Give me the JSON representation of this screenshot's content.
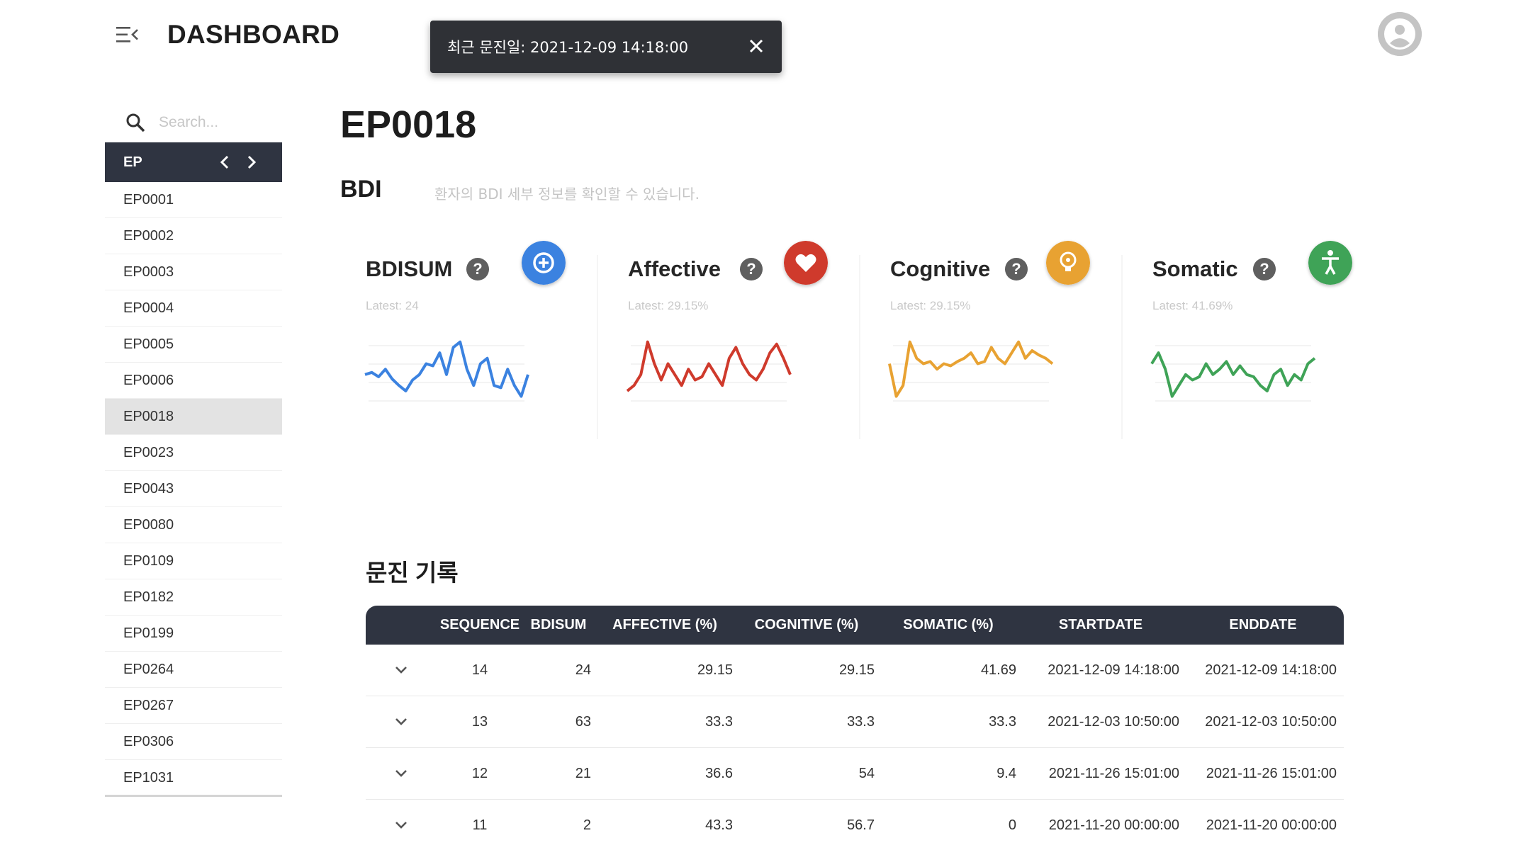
{
  "header": {
    "title": "DASHBOARD",
    "toast_text": "최근 문진일: 2021-12-09 14:18:00"
  },
  "sidebar": {
    "search_placeholder": "Search...",
    "group_label": "EP",
    "items": [
      "EP0001",
      "EP0002",
      "EP0003",
      "EP0004",
      "EP0005",
      "EP0006",
      "EP0018",
      "EP0023",
      "EP0043",
      "EP0080",
      "EP0109",
      "EP0182",
      "EP0199",
      "EP0264",
      "EP0267",
      "EP0306",
      "EP1031"
    ],
    "active_item": "EP0018"
  },
  "main": {
    "page_title": "EP0018",
    "section_title": "BDI",
    "section_desc": "환자의 BDI 세부 정보를 확인할 수 있습니다."
  },
  "cards": [
    {
      "title": "BDISUM",
      "latest": "Latest: 24",
      "color": "#3b82e0",
      "icon": "plus-circle-icon",
      "series": [
        30,
        32,
        28,
        35,
        26,
        20,
        15,
        25,
        30,
        40,
        38,
        50,
        30,
        55,
        60,
        35,
        20,
        40,
        45,
        20,
        18,
        35,
        20,
        10,
        30
      ]
    },
    {
      "title": "Affective",
      "latest": "Latest: 29.15%",
      "color": "#cf3a2c",
      "icon": "heart-icon",
      "series": [
        15,
        20,
        30,
        60,
        40,
        25,
        40,
        30,
        20,
        35,
        25,
        28,
        40,
        30,
        20,
        45,
        55,
        40,
        30,
        25,
        35,
        50,
        58,
        45,
        30
      ]
    },
    {
      "title": "Cognitive",
      "latest": "Latest: 29.15%",
      "color": "#e8a232",
      "icon": "lightbulb-icon",
      "series": [
        40,
        10,
        20,
        60,
        45,
        40,
        42,
        35,
        40,
        38,
        42,
        45,
        50,
        40,
        42,
        55,
        45,
        40,
        50,
        60,
        45,
        52,
        48,
        45,
        40
      ]
    },
    {
      "title": "Somatic",
      "latest": "Latest: 41.69%",
      "color": "#3fa357",
      "icon": "accessibility-icon",
      "series": [
        40,
        50,
        35,
        10,
        20,
        30,
        25,
        28,
        40,
        30,
        35,
        42,
        30,
        38,
        30,
        28,
        20,
        15,
        30,
        35,
        20,
        30,
        25,
        40,
        45
      ]
    }
  ],
  "records": {
    "title": "문진 기록",
    "columns": [
      "SEQUENCE",
      "BDISUM",
      "AFFECTIVE (%)",
      "COGNITIVE (%)",
      "SOMATIC (%)",
      "STARTDATE",
      "ENDDATE"
    ],
    "rows": [
      {
        "sequence": "14",
        "bdisum": "24",
        "affective": "29.15",
        "cognitive": "29.15",
        "somatic": "41.69",
        "startdate": "2021-12-09 14:18:00",
        "enddate": "2021-12-09 14:18:00"
      },
      {
        "sequence": "13",
        "bdisum": "63",
        "affective": "33.3",
        "cognitive": "33.3",
        "somatic": "33.3",
        "startdate": "2021-12-03 10:50:00",
        "enddate": "2021-12-03 10:50:00"
      },
      {
        "sequence": "12",
        "bdisum": "21",
        "affective": "36.6",
        "cognitive": "54",
        "somatic": "9.4",
        "startdate": "2021-11-26 15:01:00",
        "enddate": "2021-11-26 15:01:00"
      },
      {
        "sequence": "11",
        "bdisum": "2",
        "affective": "43.3",
        "cognitive": "56.7",
        "somatic": "0",
        "startdate": "2021-11-20 00:00:00",
        "enddate": "2021-11-20 00:00:00"
      }
    ]
  },
  "colors": {
    "dark_header": "#2f3441",
    "toast_bg": "#2f3136",
    "active_item_bg": "#e3e3e3"
  }
}
